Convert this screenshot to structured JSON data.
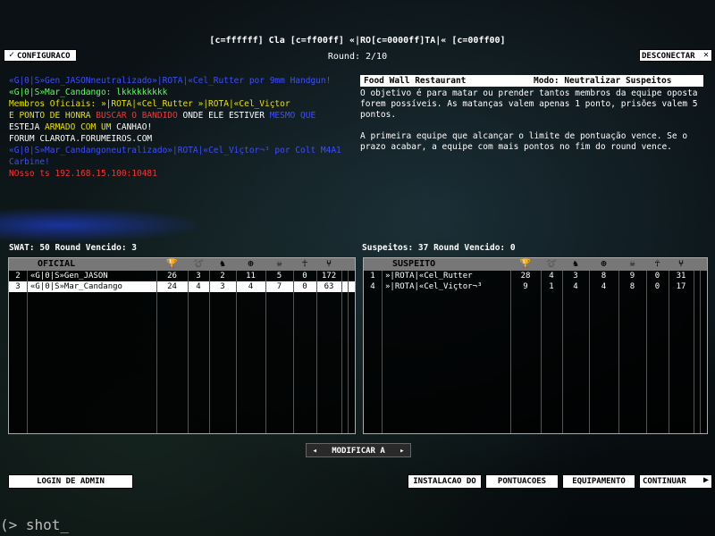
{
  "header": {
    "title": "[c=ffffff] Cla [c=ff00ff] «|RO[c=0000ff]TA|« [c=00ff00]",
    "round": "Round: 2/10",
    "config_label": "CONFIGURACO",
    "disconnect_label": "DESCONECTAR"
  },
  "chat": [
    [
      {
        "t": "«G|0|S»Gen_JASON",
        "c": "#3f4dff"
      },
      {
        "t": "neutralizado»",
        "c": "#3f4dff"
      },
      {
        "t": "|ROTA|«Cel_Rutter",
        "c": "#3f4dff"
      },
      {
        "t": " por 9mm Handgun!",
        "c": "#3f4dff"
      }
    ],
    [
      {
        "t": "«G|0|S»Mar_Candango",
        "c": "#5cff5c"
      },
      {
        "t": ": lkkkkkkkkk",
        "c": "#5cff5c"
      }
    ],
    [
      {
        "t": "Membros Oficiais: »|ROTA|«Cel_Rutter »|ROTA|«Cel_Viçtor",
        "c": "#e6e000"
      }
    ],
    [
      {
        "t": " E PONTO DE HONRA ",
        "c": "#e6e000"
      },
      {
        "t": " BUSCAR O BANDIDO ",
        "c": "#ff3030"
      },
      {
        "t": " ONDE ELE ESTIVER ",
        "c": "#ffffff"
      },
      {
        "t": " MESMO QUE",
        "c": "#3f4dff"
      }
    ],
    [
      {
        "t": "ESTEJA ",
        "c": "#ffffff"
      },
      {
        "t": " ARMADO COM UM ",
        "c": "#e6e000"
      },
      {
        "t": " CANHAO!",
        "c": "#ffffff"
      }
    ],
    [
      {
        "t": "FORUM CLAROTA.FORUMEIROS.COM",
        "c": "#ffffff"
      }
    ],
    [
      {
        "t": "«G|0|S»Mar_Candango",
        "c": "#3f4dff"
      },
      {
        "t": "neutralizado»",
        "c": "#3f4dff"
      },
      {
        "t": "|ROTA|«Cel_Viçtor¬³",
        "c": "#3f4dff"
      },
      {
        "t": " por Colt M4A1",
        "c": "#3f4dff"
      }
    ],
    [
      {
        "t": "Carbine!",
        "c": "#3f4dff"
      }
    ],
    [
      {
        "t": " NOsso ts 192.168.15.100:10481",
        "c": "#ff3030"
      }
    ]
  ],
  "info": {
    "map": "Food Wall Restaurant",
    "mode": "Modo: Neutralizar Suspeitos",
    "para1": "O objetivo é para matar ou prender tantos membros da equipe oposta forem possíveis.  As matanças valem apenas 1 ponto, prisões valem 5 pontos.",
    "para2": "A primeira equipe que alcançar o limite de pontuação vence.  Se o prazo acabar, a equipe com mais pontos no fim do round vence."
  },
  "swat": {
    "stat": "SWAT: 50   Round Vencido: 3",
    "header": "OFICIAL",
    "rows": [
      {
        "n": "2",
        "name": "«G|0|S»Gen_JASON",
        "v": [
          "26",
          "3",
          "2",
          "11",
          "5",
          "0",
          "172"
        ],
        "sel": false
      },
      {
        "n": "3",
        "name": "«G|0|S»Mar_Candango",
        "v": [
          "24",
          "4",
          "3",
          "4",
          "7",
          "0",
          "63"
        ],
        "sel": true
      }
    ]
  },
  "suspects": {
    "stat": "Suspeitos: 37   Round Vencido: 0",
    "header": "SUSPEITO",
    "rows": [
      {
        "n": "1",
        "name": "»|ROTA|«Cel_Rutter",
        "v": [
          "28",
          "4",
          "3",
          "8",
          "9",
          "0",
          "31"
        ],
        "sel": false
      },
      {
        "n": "4",
        "name": "»|ROTA|«Cel_Viçtor¬³",
        "v": [
          "9",
          "1",
          "4",
          "4",
          "8",
          "0",
          "17"
        ],
        "sel": false
      }
    ]
  },
  "icons": [
    "trophy-icon",
    "handcuffs-icon",
    "arrest-icon",
    "crosshair-icon",
    "skull-icon",
    "medal-icon",
    "ping-icon"
  ],
  "icon_glyphs": [
    "🏆",
    "➰",
    "♞",
    "⊕",
    "☠",
    "☥",
    "⑂"
  ],
  "footer": {
    "modify_label": "MODIFICAR A",
    "admin_label": "LOGIN DE ADMIN",
    "install_label": "INSTALACAO DO",
    "scores_label": "PONTUACOES",
    "equip_label": "EQUIPAMENTO",
    "continue_label": "CONTINUAR"
  },
  "console": "(> shot_"
}
